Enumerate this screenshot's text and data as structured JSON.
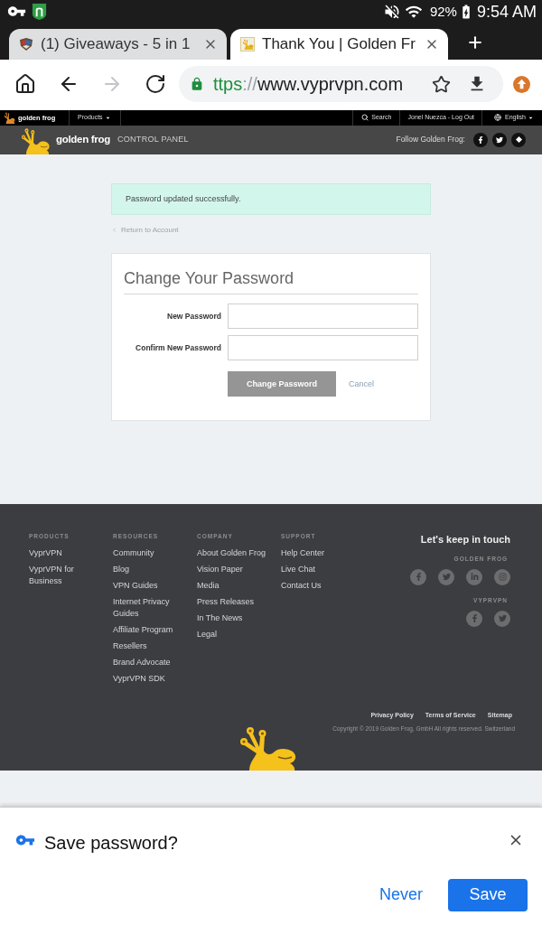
{
  "status_bar": {
    "battery": "92%",
    "time": "9:54 AM"
  },
  "browser": {
    "tabs": [
      {
        "title": "(1) Giveaways - 5 in 1",
        "selected": false
      },
      {
        "title": "Thank You | Golden Fr",
        "selected": true
      }
    ],
    "nav_buttons": [
      {
        "kind": "home",
        "disabled": false
      },
      {
        "kind": "back",
        "disabled": false
      },
      {
        "kind": "forward",
        "disabled": true
      },
      {
        "kind": "reload",
        "disabled": false
      }
    ],
    "address": {
      "scheme": "ttps",
      "separator": "://",
      "host": "www.vyprvpn.com"
    }
  },
  "site_nav": {
    "brand": "golden frog",
    "menu": "Products",
    "search": "Search",
    "account": "Jonel Nuezca - Log Out",
    "language": "English"
  },
  "header": {
    "brand": "golden frog",
    "section": "CONTROL PANEL",
    "follow": "Follow Golden Frog:"
  },
  "page": {
    "alert": "Password updated successfully.",
    "back_link": "Return to Account",
    "form": {
      "title": "Change Your Password",
      "fields": [
        {
          "label": "New Password"
        },
        {
          "label": "Confirm New Password"
        }
      ],
      "submit": {
        "label": "Change Password",
        "disabled": true
      },
      "cancel": "Cancel"
    }
  },
  "footer": {
    "columns": [
      {
        "heading": "PRODUCTS",
        "links": [
          "VyprVPN",
          "VyprVPN for Business"
        ]
      },
      {
        "heading": "RESOURCES",
        "links": [
          "Community",
          "Blog",
          "VPN Guides",
          "Internet Privacy Guides",
          "Affiliate Program",
          "Resellers",
          "Brand Advocate",
          "VyprVPN SDK"
        ]
      },
      {
        "heading": "COMPANY",
        "links": [
          "About Golden Frog",
          "Vision Paper",
          "Media",
          "Press Releases",
          "In The News",
          "Legal"
        ]
      },
      {
        "heading": "SUPPORT",
        "links": [
          "Help Center",
          "Live Chat",
          "Contact Us"
        ]
      }
    ],
    "social": {
      "title": "Let's keep in touch",
      "groups": [
        {
          "heading": "GOLDEN FROG"
        },
        {
          "heading": "VYPRVPN"
        }
      ]
    },
    "legal_links": [
      "Privacy Policy",
      "Terms of Service",
      "Sitemap"
    ],
    "copyright": "Copyright © 2019 Golden Frog, GmbH All rights reserved. Switzerland"
  },
  "save_password_prompt": {
    "title": "Save password?",
    "never": "Never",
    "save": "Save"
  }
}
